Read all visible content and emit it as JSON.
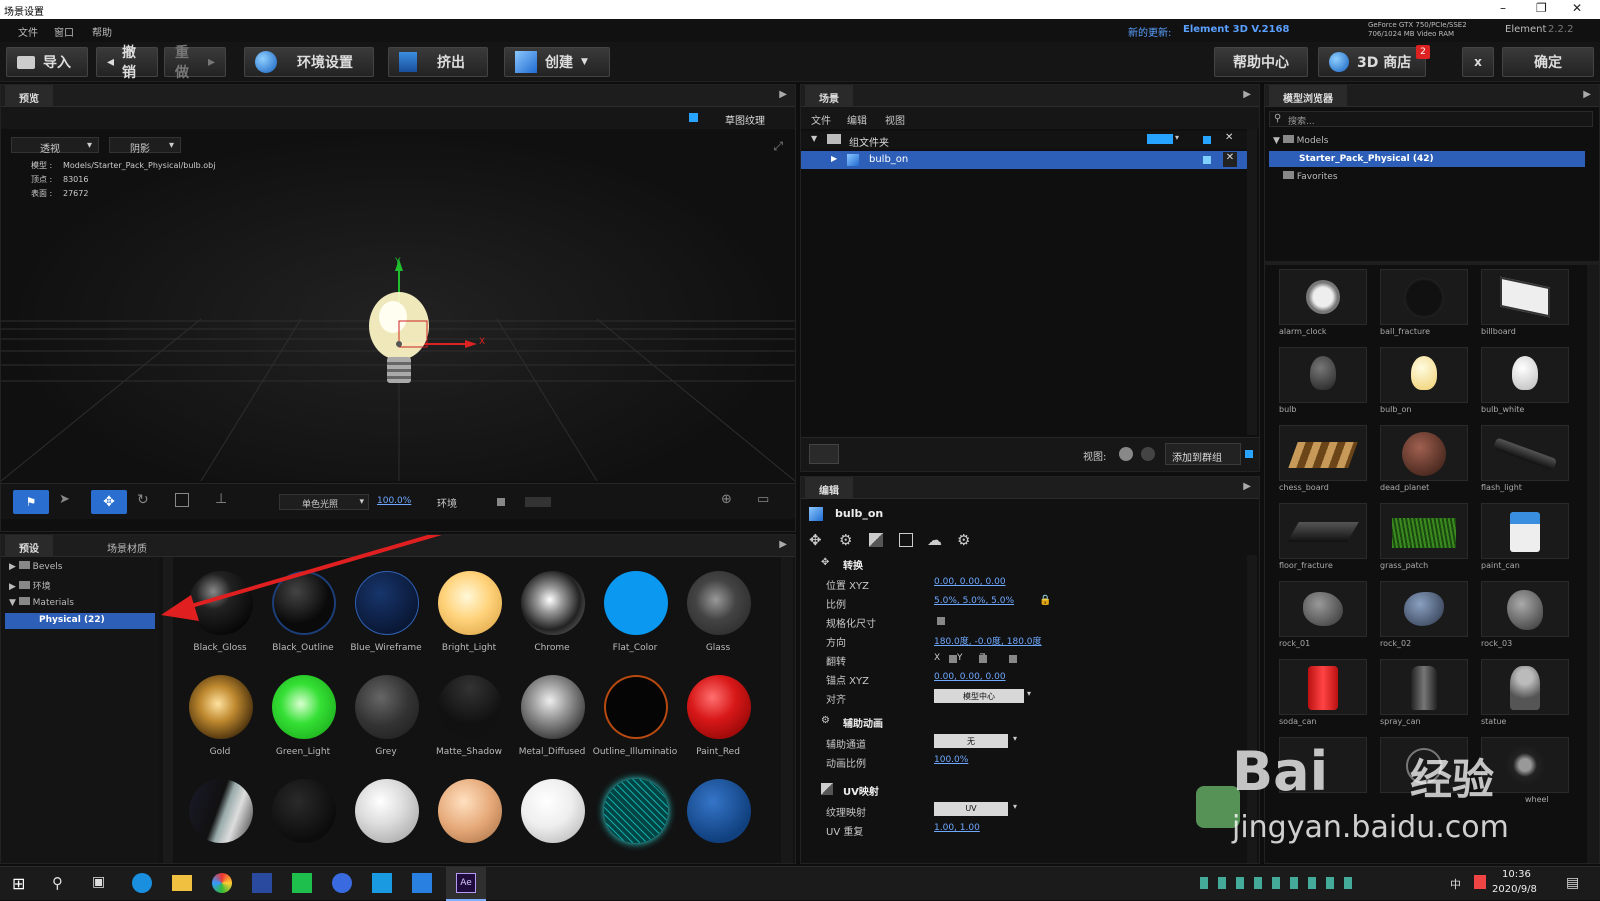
{
  "window": {
    "title": "场景设置"
  },
  "menu": {
    "items": [
      "文件",
      "窗口",
      "帮助"
    ],
    "update_label": "新的更新:",
    "update_version": "Element 3D V.2168",
    "gpu": "GeForce GTX 750/PCIe/SSE2",
    "vram": "706/1024 MB Video RAM",
    "brand": "Element",
    "brand_ver": "2.2.2"
  },
  "toolbar": {
    "import": "导入",
    "undo": "撤销",
    "redo": "重做",
    "env": "环境设置",
    "extrude": "挤出",
    "create": "创建",
    "help": "帮助中心",
    "store": "3D 商店",
    "store_badge": "2",
    "close": "x",
    "ok": "确定"
  },
  "preview": {
    "tab": "预览",
    "draft_texture": "草图纹理",
    "view_mode": "透视",
    "shadow": "阴影",
    "info_labels": [
      "模型 :",
      "顶点 :",
      "表面 :"
    ],
    "info_values": [
      "Models/Starter_Pack_Physical/bulb.obj",
      "83016",
      "27672"
    ],
    "axis_y": "Y",
    "axis_x": "X",
    "light_mode": "单色光照",
    "zoom": "100.0%",
    "env": "环境"
  },
  "presets": {
    "tabs": [
      "预设",
      "场景材质"
    ],
    "tree": [
      "Bevels",
      "环境",
      "Materials",
      "Physical (22)"
    ],
    "materials": [
      "Black_Gloss",
      "Black_Outline",
      "Blue_Wireframe",
      "Bright_Light",
      "Chrome",
      "Flat_Color",
      "Glass",
      "Gold",
      "Green_Light",
      "Grey",
      "Matte_Shadow",
      "Metal_Diffused",
      "Outline_Illuminatio",
      "Paint_Red"
    ]
  },
  "scene": {
    "tab": "场景",
    "menu": [
      "文件",
      "编辑",
      "视图"
    ],
    "group": "组文件夹",
    "item": "bulb_on",
    "view_label": "视图:",
    "add_group": "添加到群组"
  },
  "edit": {
    "tab": "编辑",
    "object": "bulb_on",
    "sec_transform": "转换",
    "sec_aux": "辅助动画",
    "sec_uv": "UV映射",
    "rows": [
      {
        "label": "位置 XYZ",
        "value": "0.00, 0.00, 0.00"
      },
      {
        "label": "比例",
        "value": "5.0%, 5.0%, 5.0%"
      },
      {
        "label": "规格化尺寸",
        "value": ""
      },
      {
        "label": "方向",
        "value": "180.0度, -0.0度, 180.0度"
      },
      {
        "label": "翻转",
        "value": "X  Y  Z"
      },
      {
        "label": "锚点 XYZ",
        "value": "0.00, 0.00, 0.00"
      },
      {
        "label": "对齐",
        "value": "模型中心"
      }
    ],
    "aux_rows": [
      {
        "label": "辅助通道",
        "value": "无"
      },
      {
        "label": "动画比例",
        "value": "100.0%"
      }
    ],
    "uv_rows": [
      {
        "label": "纹理映射",
        "value": "UV"
      },
      {
        "label": "UV 重复",
        "value": "1.00, 1.00"
      }
    ]
  },
  "browser": {
    "tab": "模型浏览器",
    "search": "搜索...",
    "tree": [
      "Models",
      "Starter_Pack_Physical (42)",
      "Favorites"
    ],
    "models": [
      "alarm_clock",
      "ball_fracture",
      "billboard",
      "bulb",
      "bulb_on",
      "bulb_white",
      "chess_board",
      "dead_planet",
      "flash_light",
      "floor_fracture",
      "grass_patch",
      "paint_can",
      "rock_01",
      "rock_02",
      "rock_03",
      "soda_can",
      "spray_can",
      "statue",
      "",
      "",
      "wheel"
    ]
  },
  "taskbar": {
    "time": "10:36",
    "date": "2020/9/8",
    "ime": "中"
  },
  "watermark": {
    "text1": "Bai",
    "text2": "经验",
    "url": "jingyan.baidu.com"
  }
}
